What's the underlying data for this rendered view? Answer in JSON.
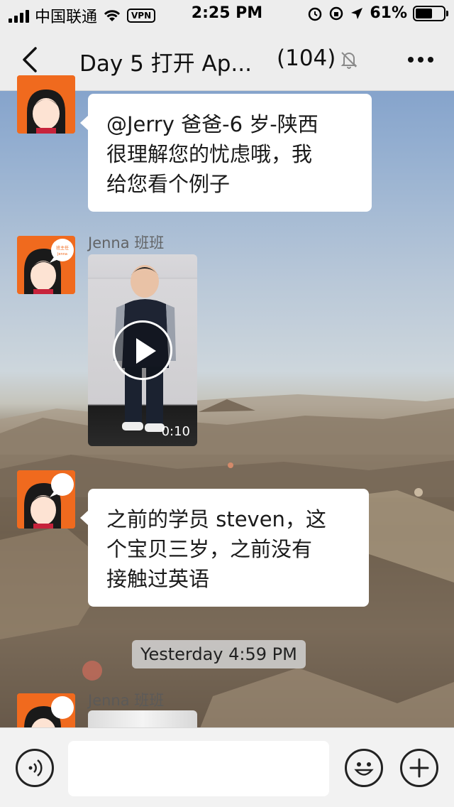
{
  "status_bar": {
    "carrier": "中国联通",
    "vpn": "VPN",
    "time": "2:25 PM",
    "battery": "61%",
    "battery_level": 0.61
  },
  "nav": {
    "title": "Day 5 打开 Ap...",
    "count": "(104)"
  },
  "messages": [
    {
      "type": "text",
      "lines": [
        "@Jerry 爸爸-6 岁-陕西",
        "很理解您的忧虑哦，我",
        "给您看个例子"
      ]
    },
    {
      "type": "video",
      "sender": "Jenna 班班",
      "duration": "0:10"
    },
    {
      "type": "text",
      "lines": [
        "之前的学员 steven，这",
        "个宝贝三岁，之前没有",
        "接触过英语"
      ]
    },
    {
      "type": "timestamp",
      "text": "Yesterday 4:59 PM"
    },
    {
      "type": "image",
      "sender": "Jenna 班班"
    }
  ],
  "avatar": {
    "badge_top": "班主任",
    "badge_bottom": "Jenna"
  },
  "colors": {
    "accent_avatar": "#f06a1e",
    "bubble": "#ffffff",
    "bar": "#ededed"
  },
  "icons": [
    "back-icon",
    "mute-bell-icon",
    "more-icon",
    "voice-icon",
    "emoji-icon",
    "plus-icon",
    "play-icon"
  ]
}
